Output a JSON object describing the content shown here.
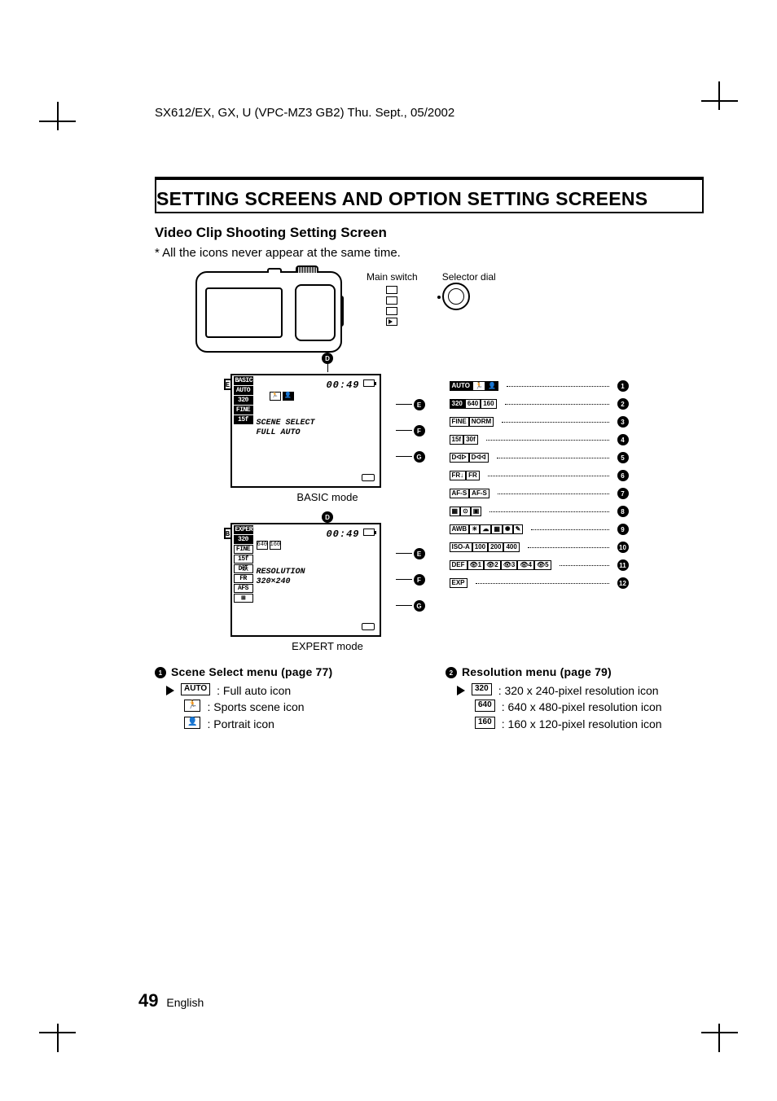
{
  "doc_header": "SX612/EX, GX, U (VPC-MZ3 GB2)    Thu. Sept., 05/2002",
  "title": "SETTING SCREENS AND OPTION SETTING SCREENS",
  "subheading": "Video Clip Shooting Setting Screen",
  "note": "*  All the icons never appear at the same time.",
  "labels": {
    "selector_dial": "Selector dial",
    "main_switch": "Main switch"
  },
  "basic_screen": {
    "tab": "E",
    "strip": [
      {
        "t": "BASIC",
        "solid": true
      },
      {
        "t": "AUTO",
        "solid": true
      },
      {
        "t": "320",
        "solid": true
      },
      {
        "t": "FINE",
        "solid": true
      },
      {
        "t": "15f",
        "solid": true
      }
    ],
    "time": "00:49",
    "line1": "SCENE SELECT",
    "line2": "FULL AUTO",
    "caption": "BASIC mode"
  },
  "expert_screen": {
    "tab": "B",
    "strip": [
      {
        "t": "EXPERT",
        "solid": true
      },
      {
        "t": "320",
        "solid": true
      },
      {
        "t": "FINE",
        "solid": false
      },
      {
        "t": "15f",
        "solid": false
      },
      {
        "t": "D䂠",
        "solid": false
      },
      {
        "t": "FR",
        "solid": false
      },
      {
        "t": "AFS",
        "solid": false
      },
      {
        "t": "▦",
        "solid": false
      }
    ],
    "row2": [
      "640",
      "160"
    ],
    "time": "00:49",
    "line1": "RESOLUTION",
    "line2": "320×240",
    "caption": "EXPERT mode"
  },
  "callouts": {
    "c14": "D",
    "c15": "E",
    "c16": "F",
    "c17": "G"
  },
  "ref_rows": [
    {
      "n": "1",
      "icons": [
        {
          "t": "AUTO",
          "s": true
        },
        {
          "t": "🏃",
          "s": false
        },
        {
          "t": "👤",
          "s": true
        }
      ]
    },
    {
      "n": "2",
      "icons": [
        {
          "t": "320",
          "s": true
        },
        {
          "t": "640",
          "s": false
        },
        {
          "t": "160",
          "s": false
        }
      ]
    },
    {
      "n": "3",
      "icons": [
        {
          "t": "FINE",
          "s": false
        },
        {
          "t": "NORM",
          "s": false
        }
      ]
    },
    {
      "n": "4",
      "icons": [
        {
          "t": "15f",
          "s": false
        },
        {
          "t": "30f",
          "s": false
        }
      ]
    },
    {
      "n": "5",
      "icons": [
        {
          "t": "Dᐊᐅ",
          "s": false
        },
        {
          "t": "Dᐊᐊ",
          "s": false
        }
      ]
    },
    {
      "n": "6",
      "icons": [
        {
          "t": "FR↓",
          "s": false
        },
        {
          "t": "FR",
          "s": false
        }
      ]
    },
    {
      "n": "7",
      "icons": [
        {
          "t": "AF-S",
          "s": false
        },
        {
          "t": "AF-S",
          "s": false
        }
      ]
    },
    {
      "n": "8",
      "icons": [
        {
          "t": "▦",
          "s": false
        },
        {
          "t": "⊙",
          "s": false
        },
        {
          "t": "▣",
          "s": false
        }
      ]
    },
    {
      "n": "9",
      "icons": [
        {
          "t": "AWB",
          "s": false
        },
        {
          "t": "☀",
          "s": false
        },
        {
          "t": "☁",
          "s": false
        },
        {
          "t": "▦",
          "s": false
        },
        {
          "t": "✺",
          "s": false
        },
        {
          "t": "✎",
          "s": false
        }
      ]
    },
    {
      "n": "10",
      "icons": [
        {
          "t": "ISO-A",
          "s": false
        },
        {
          "t": "100",
          "s": false
        },
        {
          "t": "200",
          "s": false
        },
        {
          "t": "400",
          "s": false
        }
      ]
    },
    {
      "n": "11",
      "icons": [
        {
          "t": "DEF",
          "s": false
        },
        {
          "t": "👁1",
          "s": false
        },
        {
          "t": "👁2",
          "s": false
        },
        {
          "t": "👁3",
          "s": false
        },
        {
          "t": "👁4",
          "s": false
        },
        {
          "t": "👁5",
          "s": false
        }
      ]
    },
    {
      "n": "12",
      "icons": [
        {
          "t": "EXP",
          "s": false
        }
      ]
    }
  ],
  "menu_left": {
    "head": "Scene Select menu (page 77)",
    "items": [
      {
        "cursor": true,
        "icon": "AUTO",
        "text": ": Full auto icon"
      },
      {
        "cursor": false,
        "icon": "🏃",
        "text": ": Sports scene icon"
      },
      {
        "cursor": false,
        "icon": "👤",
        "text": ": Portrait icon"
      }
    ]
  },
  "menu_right": {
    "head": "Resolution menu (page 79)",
    "items": [
      {
        "cursor": true,
        "icon": "320",
        "text": ": 320 x 240-pixel resolution icon"
      },
      {
        "cursor": false,
        "icon": "640",
        "text": ": 640 x 480-pixel resolution icon"
      },
      {
        "cursor": false,
        "icon": "160",
        "text": ": 160 x 120-pixel resolution icon"
      }
    ]
  },
  "footer": {
    "page": "49",
    "lang": "English"
  }
}
